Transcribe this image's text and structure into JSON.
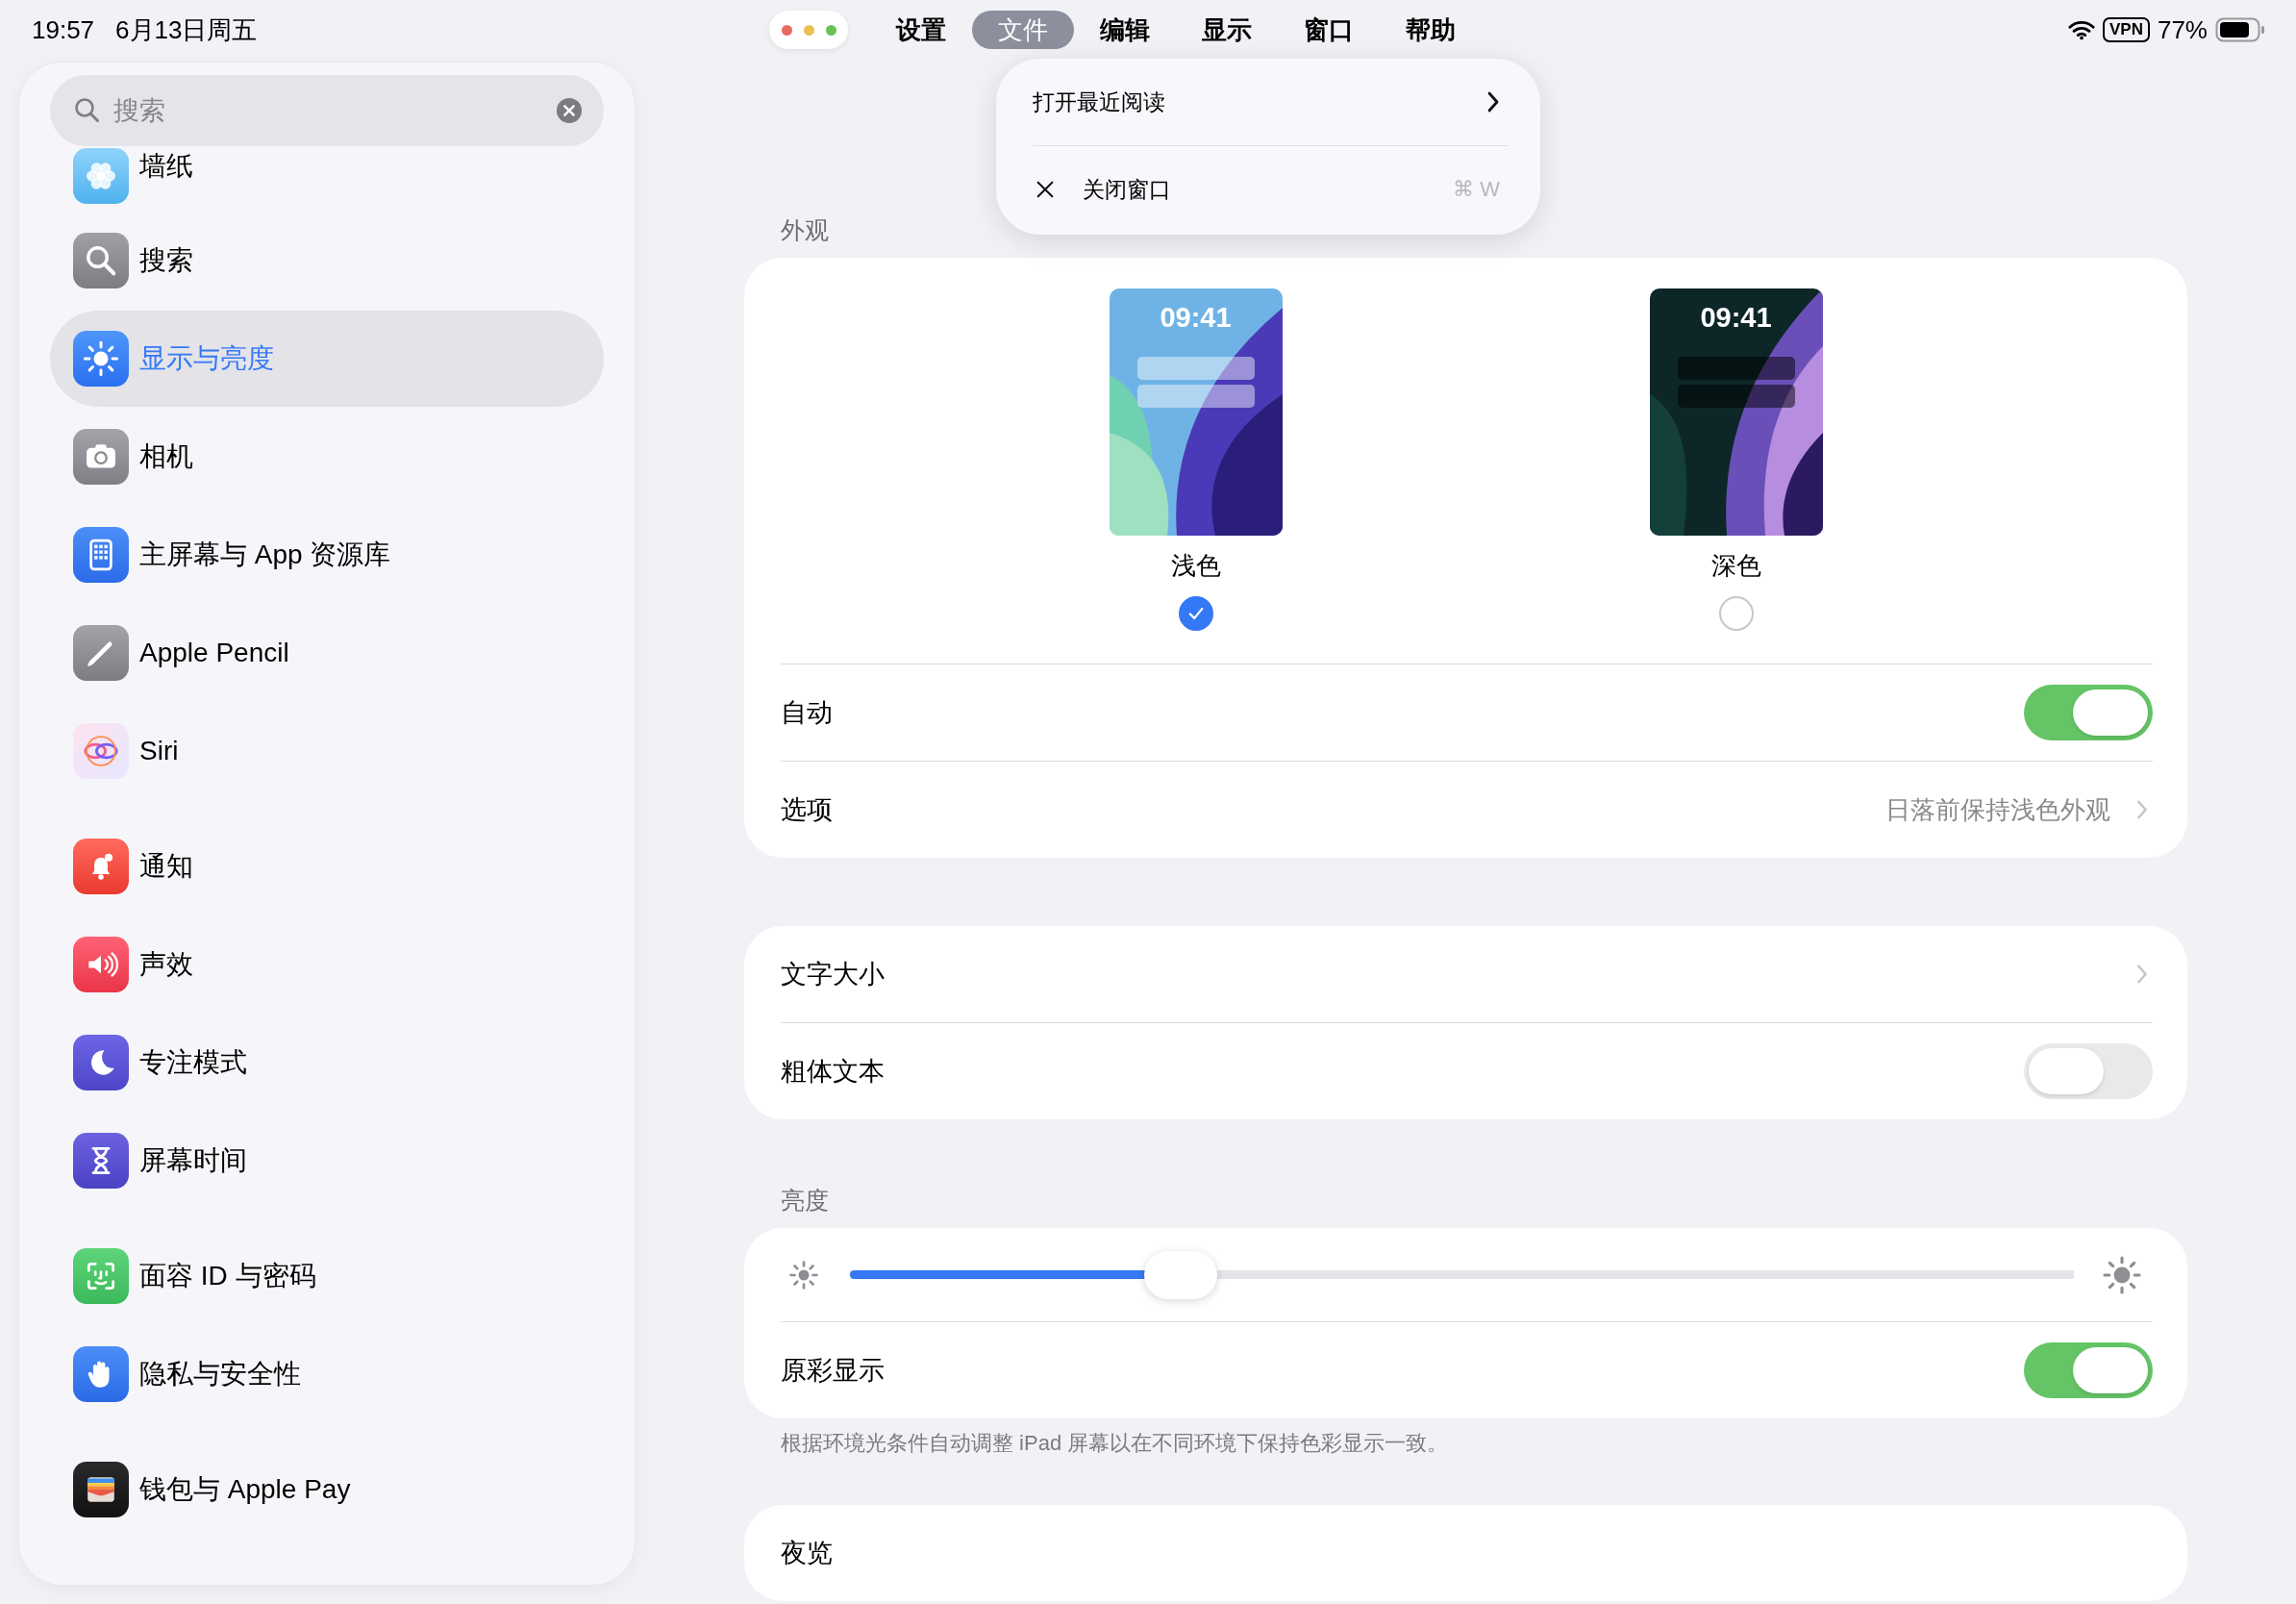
{
  "status_bar": {
    "time": "19:57",
    "date": "6月13日周五",
    "vpn": "VPN",
    "battery": "77%"
  },
  "menu_bar": {
    "items": [
      {
        "label": "设置",
        "selected": false
      },
      {
        "label": "文件",
        "selected": true
      },
      {
        "label": "编辑",
        "selected": false
      },
      {
        "label": "显示",
        "selected": false
      },
      {
        "label": "窗口",
        "selected": false
      },
      {
        "label": "帮助",
        "selected": false
      }
    ]
  },
  "dropdown": {
    "items": [
      {
        "kind": "submenu",
        "label": "打开最近阅读"
      },
      {
        "kind": "command",
        "label": "关闭窗口",
        "shortcut": "⌘ W"
      }
    ]
  },
  "sidebar": {
    "search": {
      "placeholder": "搜索"
    },
    "groups": [
      {
        "items": [
          {
            "label": "墙纸",
            "selected": false
          },
          {
            "label": "搜索",
            "selected": false
          },
          {
            "label": "显示与亮度",
            "selected": true
          },
          {
            "label": "相机",
            "selected": false
          },
          {
            "label": "主屏幕与 App 资源库",
            "selected": false
          },
          {
            "label": "Apple Pencil",
            "selected": false
          },
          {
            "label": "Siri",
            "selected": false
          }
        ]
      },
      {
        "items": [
          {
            "label": "通知",
            "selected": false
          },
          {
            "label": "声效",
            "selected": false
          },
          {
            "label": "专注模式",
            "selected": false
          },
          {
            "label": "屏幕时间",
            "selected": false
          }
        ]
      },
      {
        "items": [
          {
            "label": "面容 ID 与密码",
            "selected": false
          },
          {
            "label": "隐私与安全性",
            "selected": false
          }
        ]
      },
      {
        "items": [
          {
            "label": "钱包与 Apple Pay",
            "selected": false
          }
        ]
      }
    ]
  },
  "sections": [
    {
      "header": "外观",
      "appearance": {
        "options": [
          {
            "kind": "light",
            "label": "浅色",
            "time": "09:41",
            "selected": true
          },
          {
            "kind": "dark",
            "label": "深色",
            "time": "09:41",
            "selected": false
          }
        ]
      },
      "rows": [
        {
          "kind": "toggle",
          "label": "自动",
          "on": true
        },
        {
          "kind": "link",
          "label": "选项",
          "value": "日落前保持浅色外观"
        }
      ]
    },
    {
      "rows": [
        {
          "kind": "link",
          "label": "文字大小"
        },
        {
          "kind": "toggle",
          "label": "粗体文本",
          "on": false
        }
      ]
    },
    {
      "header": "亮度",
      "rows": [
        {
          "kind": "slider",
          "level": 0.27
        },
        {
          "kind": "toggle",
          "label": "原彩显示",
          "on": true
        }
      ],
      "footer": "根据环境光条件自动调整 iPad 屏幕以在不同环境下保持色彩显示一致。"
    },
    {
      "rows": [
        {
          "kind": "plain",
          "label": "夜览"
        }
      ]
    }
  ]
}
